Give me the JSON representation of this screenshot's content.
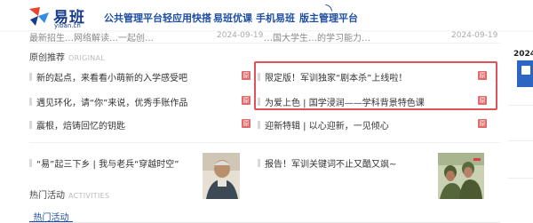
{
  "header": {
    "logo": {
      "name": "易班",
      "domain": "yiban.cn"
    },
    "nav": [
      "公共管理平台",
      "轻应用快搭",
      "易班优课",
      "手机易班",
      "版主管理平台"
    ]
  },
  "top_rows": [
    {
      "text": "最新招生…网络解读…一起创…",
      "date": "2024-09-19"
    },
    {
      "text": "…国大学生…的学习能力…",
      "date": "2024-09-19"
    }
  ],
  "original": {
    "title": "原创推荐",
    "title_en": "ORIGINAL",
    "badge": "原",
    "items": [
      "新的起点，来看看小萌新的入学感受吧",
      "限定版！军训独家“剧本杀”上线啦！",
      "遇见环化，请“你”来说，优秀手账作品",
      "为爱上色 | 国学浸润——学科背景特色课",
      "震根，焙铸回忆的钥匙",
      "迎新特辑 | 以心迎新，一见倾心"
    ]
  },
  "news": {
    "items": [
      "“易”起三下乡 | 我与老兵“穿越时空”",
      "报告！军训关键词不止又酷又飒~"
    ]
  },
  "activities": {
    "title": "热门活动",
    "title_en": "ACTIVITIES",
    "tab": "热门活动"
  },
  "sidebar": {
    "year": "2024"
  },
  "colors": {
    "brand": "#1e4fa3",
    "highlight": "#e05257",
    "badge": "#e06a6a",
    "side_card": "#2d66c2"
  }
}
